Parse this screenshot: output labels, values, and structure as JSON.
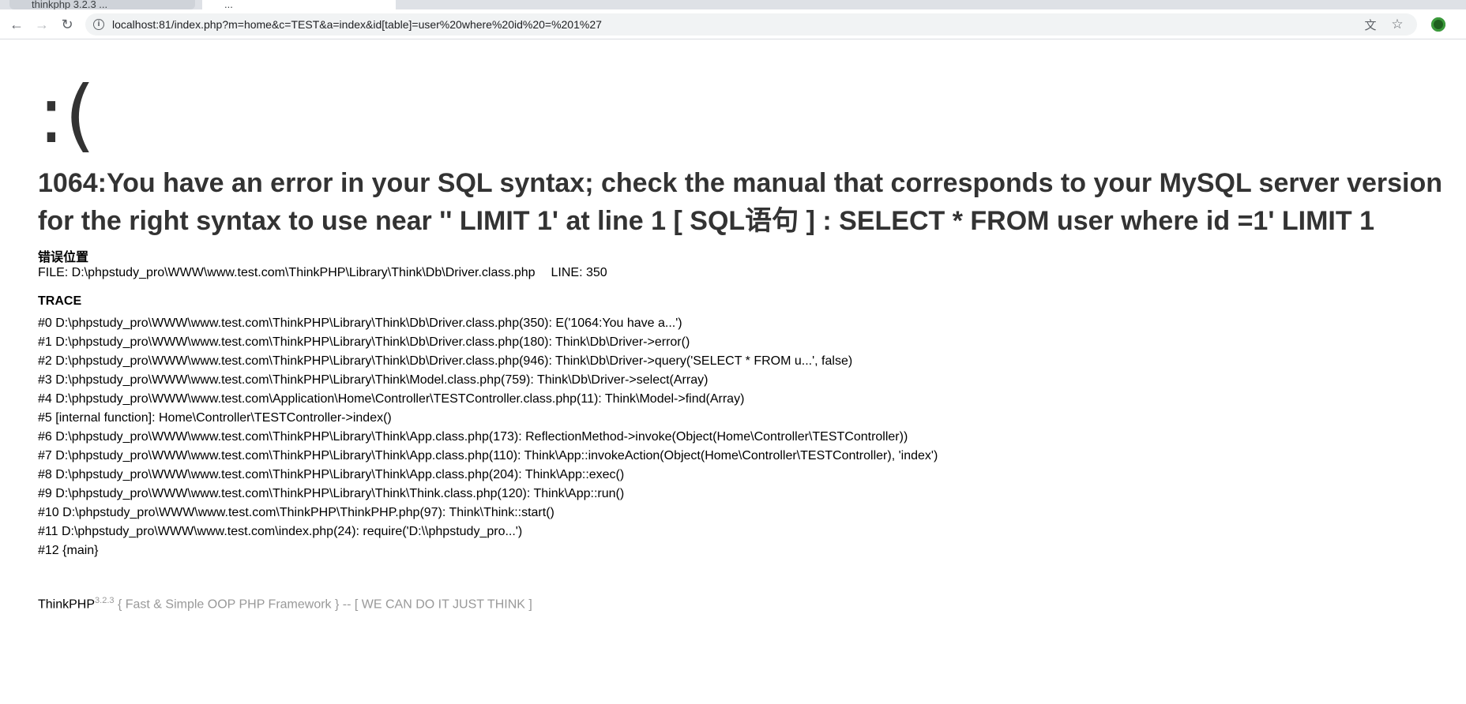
{
  "browser": {
    "tabs": [
      {
        "label": "thinkphp 3.2.3 ...",
        "active": false
      },
      {
        "label": "...",
        "active": true
      },
      {
        "label": "+",
        "active": false
      }
    ],
    "url": "localhost:81/index.php?m=home&c=TEST&a=index&id[table]=user%20where%20id%20=%201%27",
    "icons": {
      "back": "arrow-left-icon",
      "forward": "arrow-right-icon",
      "reload": "reload-icon",
      "info": "info-icon",
      "translate": "translate-icon",
      "bookmark": "star-icon",
      "profile": "profile-avatar"
    }
  },
  "error": {
    "face": ":(",
    "message": "1064:You have an error in your SQL syntax; check the manual that corresponds to your MySQL server version for the right syntax to use near '' LIMIT 1' at line 1 [ SQL语句 ] : SELECT * FROM user where id =1' LIMIT 1",
    "location_title": "错误位置",
    "file": "FILE: D:\\phpstudy_pro\\WWW\\www.test.com\\ThinkPHP\\Library\\Think\\Db\\Driver.class.php",
    "line": "LINE: 350",
    "trace_title": "TRACE",
    "trace": [
      "#0 D:\\phpstudy_pro\\WWW\\www.test.com\\ThinkPHP\\Library\\Think\\Db\\Driver.class.php(350): E('1064:You have a...')",
      "#1 D:\\phpstudy_pro\\WWW\\www.test.com\\ThinkPHP\\Library\\Think\\Db\\Driver.class.php(180): Think\\Db\\Driver->error()",
      "#2 D:\\phpstudy_pro\\WWW\\www.test.com\\ThinkPHP\\Library\\Think\\Db\\Driver.class.php(946): Think\\Db\\Driver->query('SELECT * FROM u...', false)",
      "#3 D:\\phpstudy_pro\\WWW\\www.test.com\\ThinkPHP\\Library\\Think\\Model.class.php(759): Think\\Db\\Driver->select(Array)",
      "#4 D:\\phpstudy_pro\\WWW\\www.test.com\\Application\\Home\\Controller\\TESTController.class.php(11): Think\\Model->find(Array)",
      "#5 [internal function]: Home\\Controller\\TESTController->index()",
      "#6 D:\\phpstudy_pro\\WWW\\www.test.com\\ThinkPHP\\Library\\Think\\App.class.php(173): ReflectionMethod->invoke(Object(Home\\Controller\\TESTController))",
      "#7 D:\\phpstudy_pro\\WWW\\www.test.com\\ThinkPHP\\Library\\Think\\App.class.php(110): Think\\App::invokeAction(Object(Home\\Controller\\TESTController), 'index')",
      "#8 D:\\phpstudy_pro\\WWW\\www.test.com\\ThinkPHP\\Library\\Think\\App.class.php(204): Think\\App::exec()",
      "#9 D:\\phpstudy_pro\\WWW\\www.test.com\\ThinkPHP\\Library\\Think\\Think.class.php(120): Think\\App::run()",
      "#10 D:\\phpstudy_pro\\WWW\\www.test.com\\ThinkPHP\\ThinkPHP.php(97): Think\\Think::start()",
      "#11 D:\\phpstudy_pro\\WWW\\www.test.com\\index.php(24): require('D:\\\\phpstudy_pro...')",
      "#12 {main}"
    ]
  },
  "footer": {
    "brand": "ThinkPHP",
    "version": "3.2.3",
    "tagline": "{ Fast & Simple OOP PHP Framework } -- [ WE CAN DO IT JUST THINK ]"
  }
}
